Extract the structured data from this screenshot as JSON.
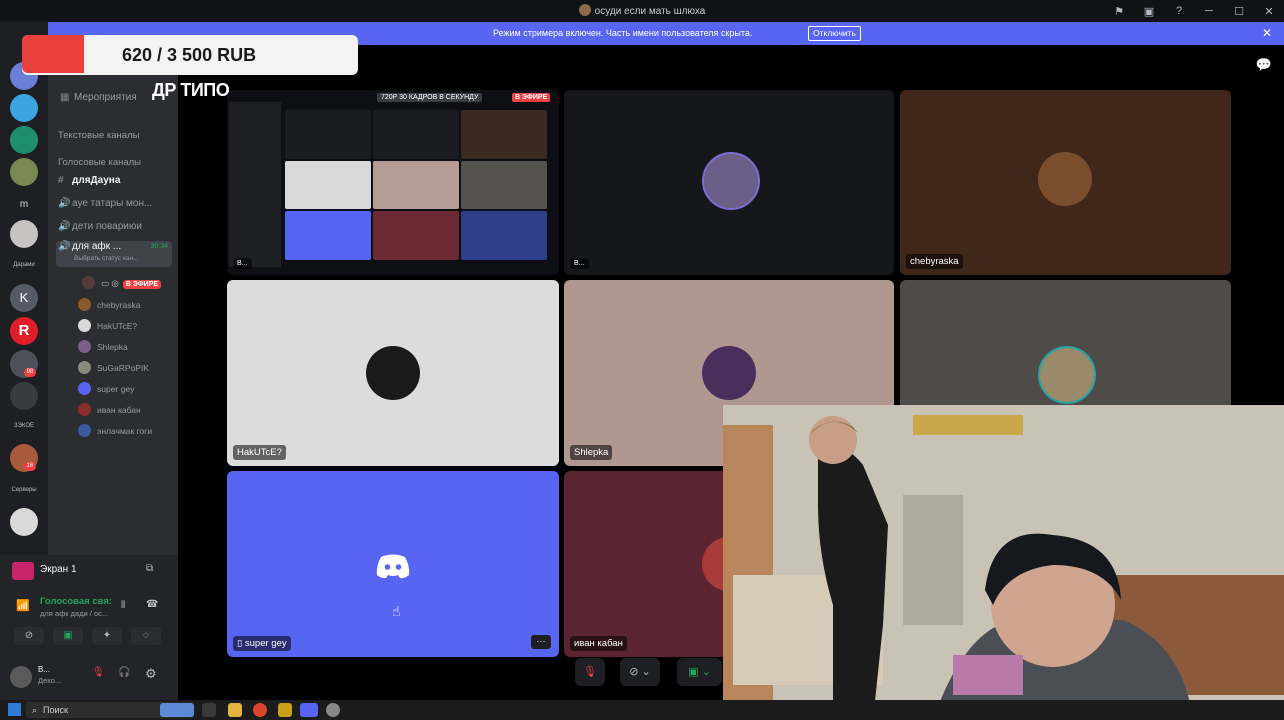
{
  "titlebar": {
    "title": "осуди если мать шлюха"
  },
  "streamer_banner": {
    "message": "Режим стримера включен. Часть имени пользователя скрыта.",
    "button": "Отключить"
  },
  "overlay": {
    "donation": "620 / 3 500 RUB",
    "caption": "ДР ТИПО"
  },
  "server_rail": {
    "labels": [
      "Дарами",
      "ЗЭКОЕ",
      "Серверы"
    ],
    "badges": [
      "98",
      "16"
    ],
    "letters": [
      "m",
      "K",
      "R"
    ]
  },
  "channels": {
    "events": "Мероприятия",
    "text_category": "Текстовые каналы",
    "voice_category": "Голосовые каналы",
    "items": [
      {
        "name": "дляДауна"
      },
      {
        "name": "ауе татары мон..."
      },
      {
        "name": "дети повариюи"
      },
      {
        "name": "для афк ...",
        "time": "30:34",
        "sub": "Выбрать статус кан..."
      }
    ],
    "live_badge": "В ЭФИРЕ",
    "voice_users": [
      "chebyraska",
      "HakUTcE?",
      "Shlepka",
      "SuGaRPoPIK",
      "super gey",
      "иван кабан",
      "энлачмак гоги"
    ]
  },
  "bottom_panel": {
    "screen": "Экран 1",
    "voice_status": "Голосовая свя:",
    "voice_sub": "для афк дади / ос...",
    "user_name": "В...",
    "user_status": "Деко..."
  },
  "stage": {
    "share_top": "720P 30 КАДРОВ В СЕКУНДУ",
    "share_live": "В ЭФИРЕ",
    "share_name": "В...",
    "tiles": [
      "chebyraska",
      "HakUTcE?",
      "Shlepka",
      "super gey",
      "иван кабан"
    ],
    "tile_dots": "···"
  },
  "taskbar": {
    "search": "Поиск"
  },
  "colors": {
    "blurple": "#5865f2",
    "dark": "#1e1f22",
    "green": "#23a55a",
    "red": "#ed4245"
  }
}
